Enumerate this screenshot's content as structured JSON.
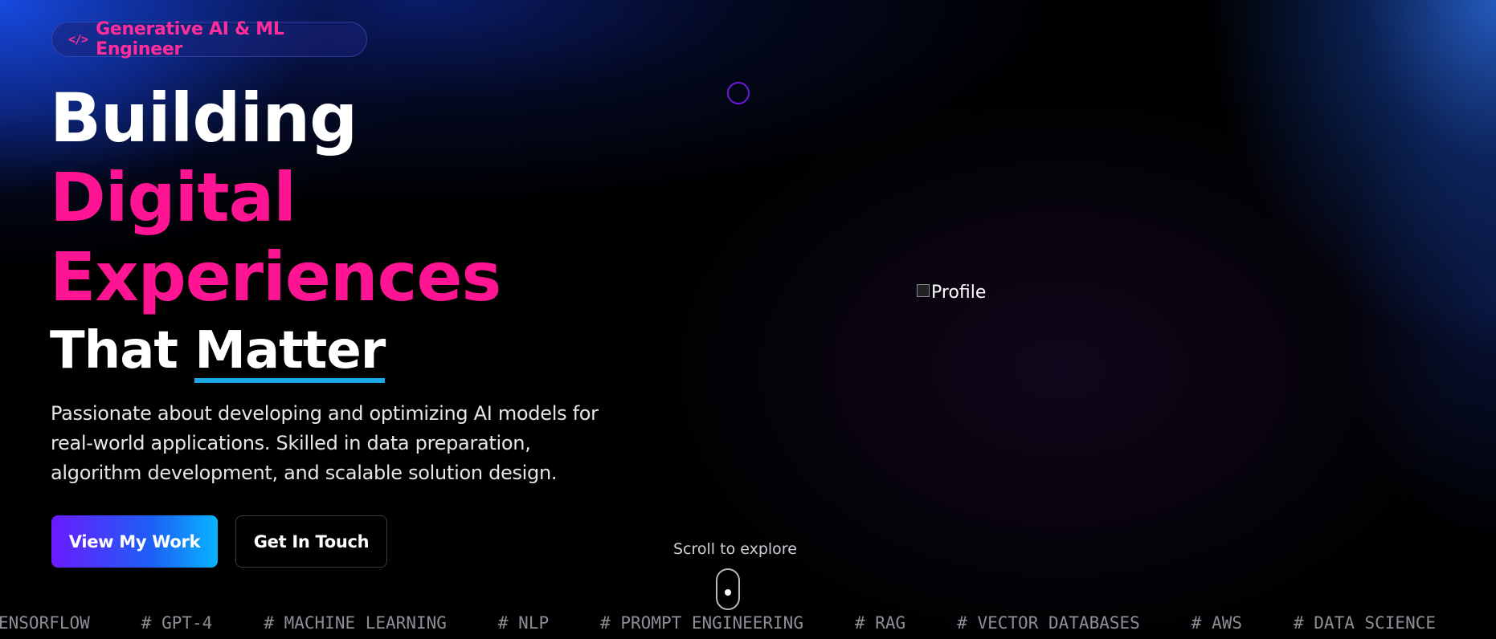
{
  "hero": {
    "badge_label": "Generative AI & ML Engineer",
    "badge_icon": "code-icon",
    "headline": {
      "line1": "Building",
      "line2": "Digital",
      "line3": "Experiences",
      "line4_prefix": "That ",
      "line4_underlined": "Matter"
    },
    "description": "Passionate about developing and optimizing AI models for real-world applications. Skilled in data preparation, algorithm development, and scalable solution design.",
    "primary_button": "View My Work",
    "secondary_button": "Get In Touch"
  },
  "profile": {
    "alt_text": "Profile"
  },
  "scroll": {
    "hint": "Scroll to explore"
  },
  "ticker": {
    "tags": [
      "ENSORFLOW",
      "# GPT-4",
      "# MACHINE LEARNING",
      "# NLP",
      "# PROMPT ENGINEERING",
      "# RAG",
      "# VECTOR DATABASES",
      "# AWS",
      "# DATA SCIENCE"
    ]
  },
  "colors": {
    "accent_pink": "#ff1493",
    "accent_blue": "#1ba7ea",
    "button_gradient_start": "#6a1bff",
    "button_gradient_end": "#08b4ff"
  }
}
